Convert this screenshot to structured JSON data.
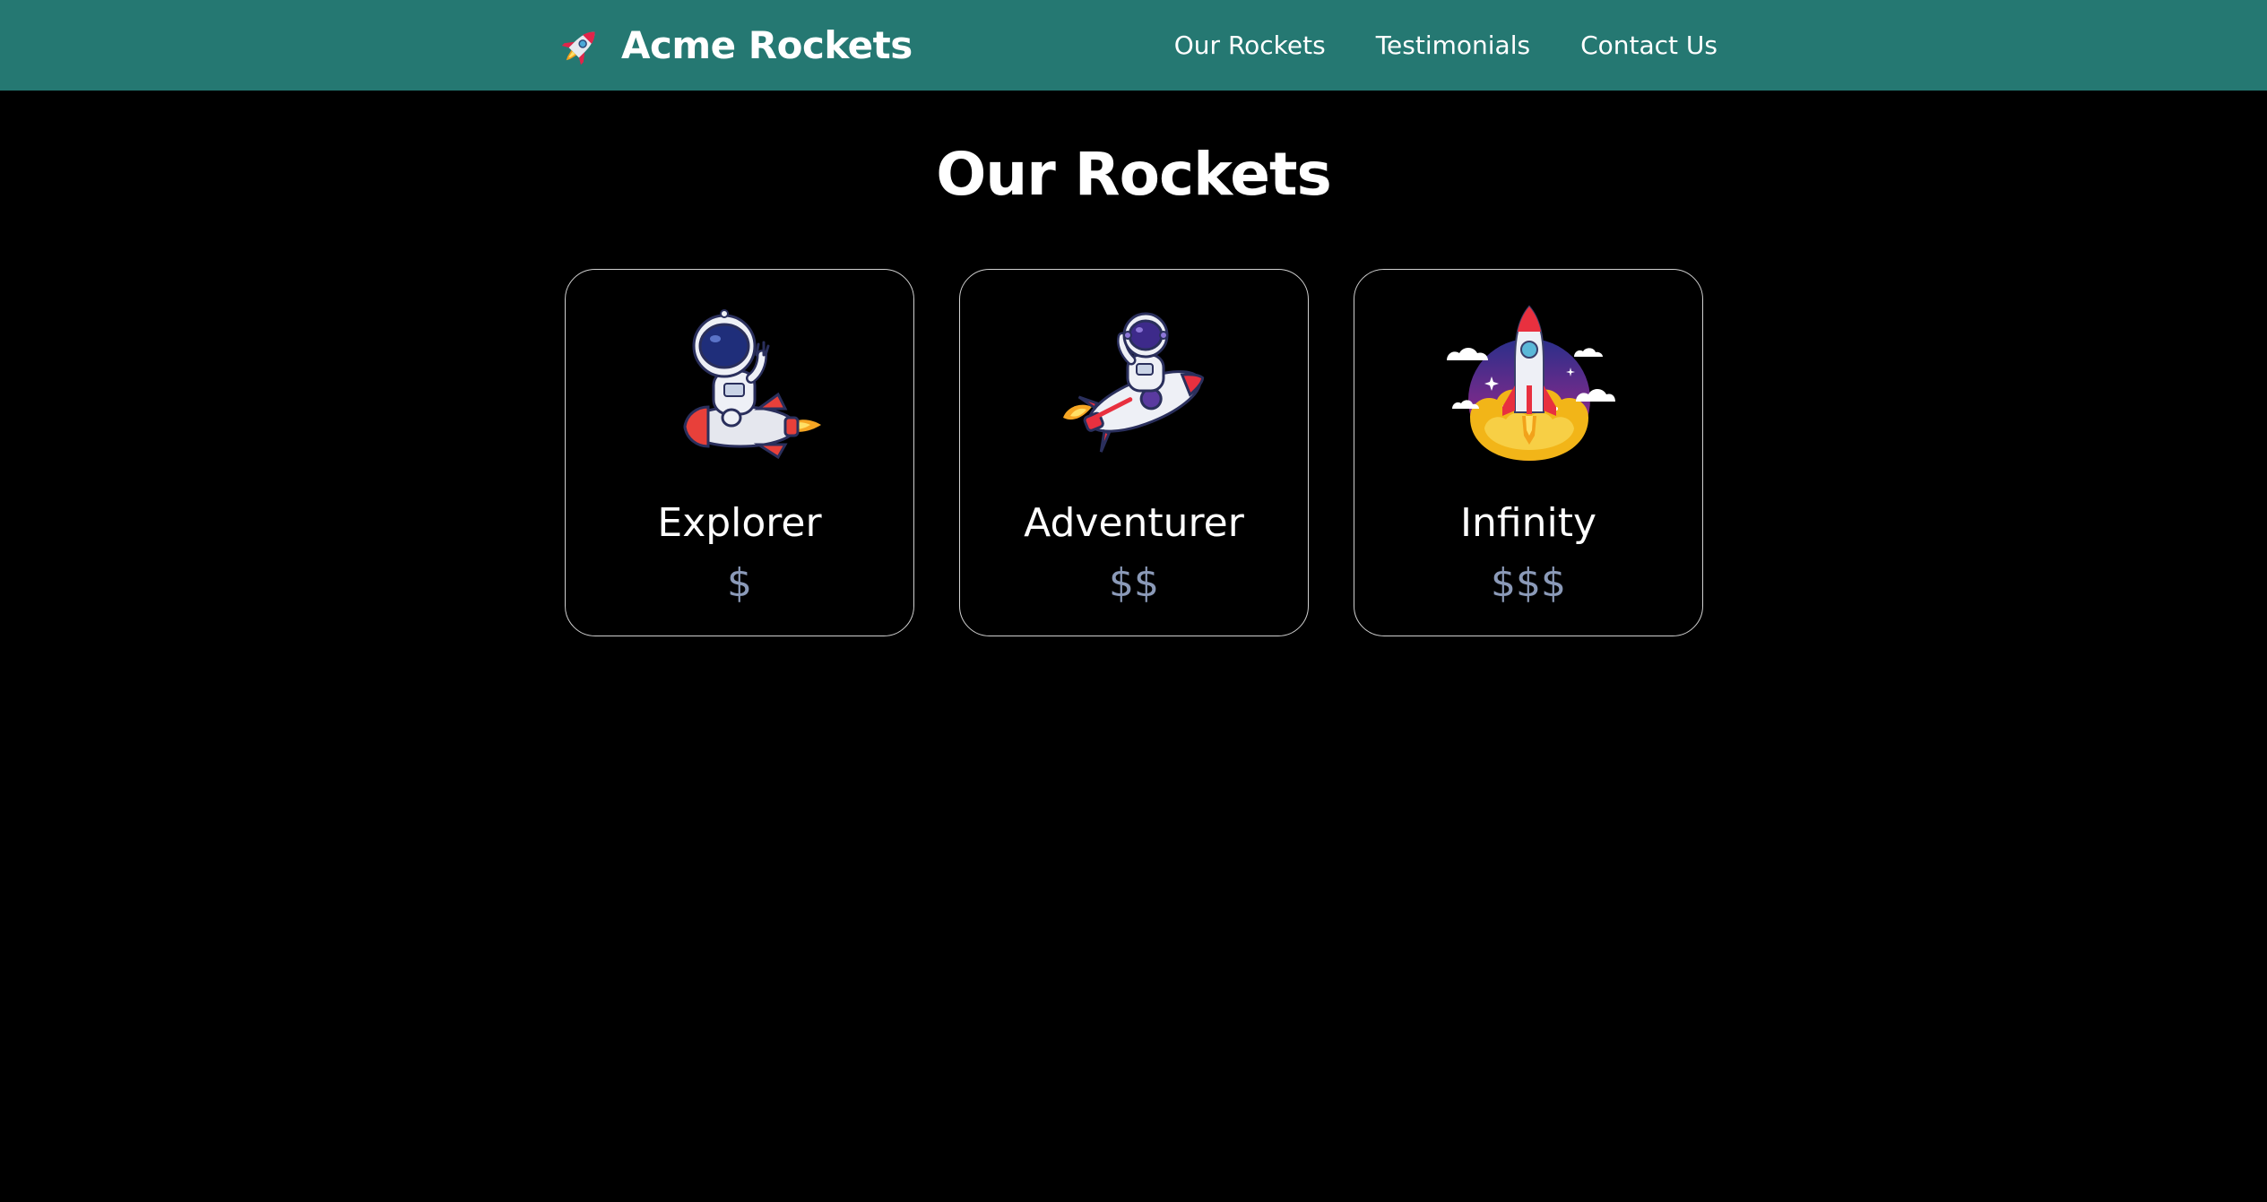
{
  "header": {
    "brand_icon": "rocket-icon",
    "brand_name": "Acme Rockets",
    "nav": [
      {
        "label": "Our Rockets"
      },
      {
        "label": "Testimonials"
      },
      {
        "label": "Contact Us"
      }
    ],
    "background_color": "#257872"
  },
  "main": {
    "title": "Our Rockets",
    "cards": [
      {
        "name": "Explorer",
        "price": "$",
        "image": "astronaut-riding-rocket"
      },
      {
        "name": "Adventurer",
        "price": "$$",
        "image": "astronaut-flying-rocket"
      },
      {
        "name": "Infinity",
        "price": "$$$",
        "image": "rocket-launch"
      }
    ],
    "price_color": "#8b9ab8",
    "card_border_color": "#d0d0d0"
  }
}
